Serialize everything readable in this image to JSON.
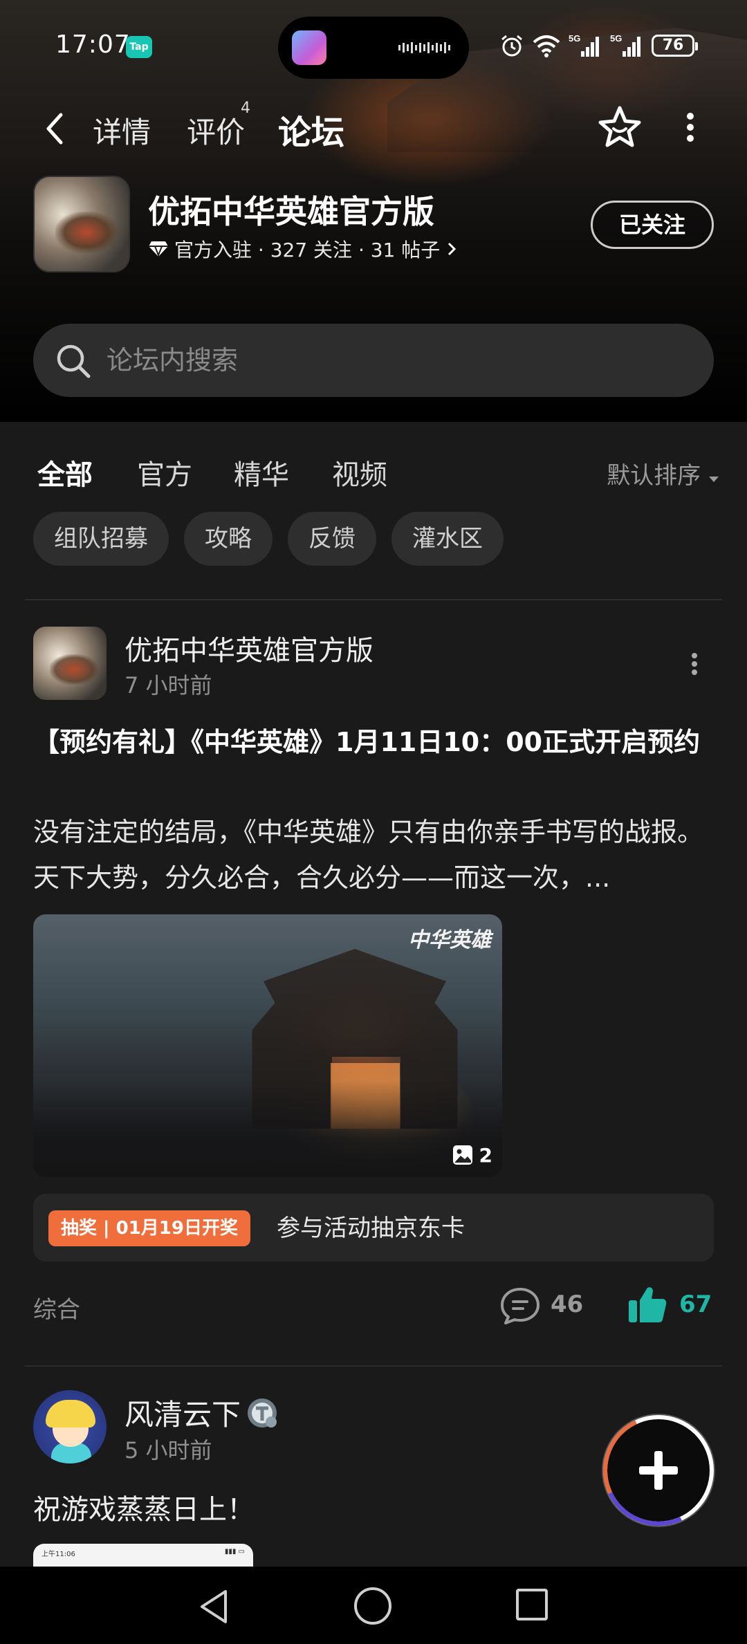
{
  "status_bar": {
    "time": "17:07",
    "app_badge": "Tap",
    "network_1": "5G",
    "network_2": "5G",
    "battery": "76"
  },
  "nav": {
    "tabs": [
      {
        "label": "详情"
      },
      {
        "label": "评价",
        "count": "4"
      },
      {
        "label": "论坛"
      }
    ],
    "active_tab": "论坛",
    "icons": [
      "back-icon",
      "star-icon",
      "more-vertical-icon"
    ]
  },
  "game": {
    "title": "优拓中华英雄官方版",
    "meta": "官方入驻 · 327 关注 · 31 帖子",
    "follow_label": "已关注"
  },
  "search": {
    "placeholder": "论坛内搜索"
  },
  "category_tabs": [
    {
      "label": "全部"
    },
    {
      "label": "官方"
    },
    {
      "label": "精华"
    },
    {
      "label": "视频"
    }
  ],
  "active_category": "全部",
  "sort_label": "默认排序",
  "chips": [
    "组队招募",
    "攻略",
    "反馈",
    "灌水区"
  ],
  "posts": [
    {
      "author": "优拓中华英雄官方版",
      "time": "7 小时前",
      "title": "【预约有礼】《中华英雄》1月11日10：00正式开启预约",
      "body": "没有注定的结局，《中华英雄》只有由你亲手书写的战报。天下大势，分久必合，合久必分——而这一次，...",
      "image_logo": "中华英雄",
      "image_count": "2",
      "lottery_badge": "抽奖 | 01月19日开奖",
      "lottery_text": "参与活动抽京东卡",
      "category": "综合",
      "comments": "46",
      "likes": "67"
    },
    {
      "author": "风清云下",
      "time": "5 小时前",
      "body": "祝游戏蒸蒸日上！",
      "thumb_status_time": "上午11:06"
    }
  ],
  "colors": {
    "accent": "#1fb6a6",
    "lottery_badge": "#f06e3c",
    "background": "#1a1a1a"
  }
}
